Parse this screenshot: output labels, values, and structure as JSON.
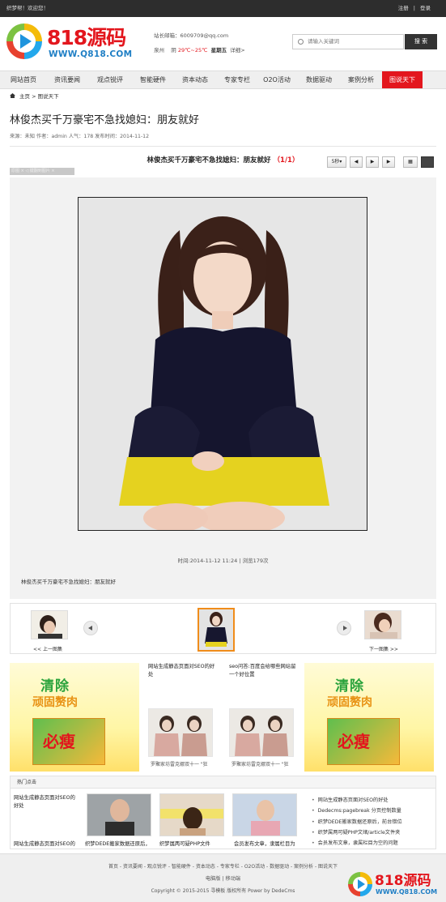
{
  "topbar": {
    "welcome": "织梦帮！欢迎您！",
    "register": "注册",
    "sep": "|",
    "login": "登录"
  },
  "logo": {
    "brand": "818源码",
    "url": "WWW.Q818.COM"
  },
  "site_info": {
    "email_label": "站长邮箱：6009709@qq.com",
    "city": "泉州",
    "weather": "阴",
    "temp": "29℃~25℃",
    "weekday": "星期五",
    "detail": "详细>"
  },
  "search": {
    "placeholder": "请输入关键词",
    "button": "搜 索"
  },
  "nav": [
    "网站首页",
    "资讯要闻",
    "观点锐评",
    "智能硬件",
    "资本动态",
    "专家专栏",
    "O2O活动",
    "数据驱动",
    "案例分析",
    "图说天下"
  ],
  "nav_active": 9,
  "breadcrumb": {
    "home": "主页",
    "sep": ">",
    "current": "图说天下"
  },
  "article": {
    "title": "林俊杰买千万豪宅不急找媳妇：朋友就好",
    "meta": "来源：未知 作者：admin 人气：178 发布时间：2014-11-12"
  },
  "gallery": {
    "title": "林俊杰买千万豪宅不急找媳妇：朋友就好",
    "page_open": "（",
    "page_current": "1",
    "page_sep": "/",
    "page_total": "1",
    "page_close": "）",
    "speed": "5秒",
    "tag": "原图  ×  ◁ 键翻到图片 ×",
    "time": "时间:2014-11-12 11:24 | 浏览179次",
    "caption": "林俊杰买千万豪宅不急找媳妇：朋友就好",
    "prev_label": "<< 上一图集",
    "next_label": "下一图集 >>"
  },
  "mid": {
    "item1": "网站生成静态页面对SEO的好处",
    "item2": "seo问答:百度会给哪些网站留一个好位置",
    "cap1": "罗聚家坊雷克娜双十一 \"狂",
    "cap2": "罗聚家坊雷克娜双十一 \"狂"
  },
  "ad": {
    "line1": "清除",
    "line2": "顽固赘肉",
    "brand": "必瘦"
  },
  "hot": {
    "header": "热门点击",
    "left_top": "网站生成静态页面对SEO的好处",
    "left_bottom": "网站生成静态页面对SEO的",
    "caps": [
      "织梦DEDE搬家数据还原后，",
      "织梦属两可疑PHP文件",
      "会员发布文章，隶属栏目为"
    ],
    "list": [
      "网站生成静态页面对SEO的好处",
      "Dedecms:pagebreak 分页控制数量",
      "织梦DEDE搬家数据还原后，前台错位",
      "织梦属两可疑PHP文绪/article文件夹",
      "会员发布文章，隶属栏目为空的问题"
    ]
  },
  "footer": {
    "links": "首页 - 资讯要闻 - 观点锐评 - 智能硬件 - 资本动态 - 专家专栏 - O2O活动 - 数据驱动 - 案例分析 - 图说天下",
    "sub": "电脑版 | 移动端",
    "copyright": "Copyright © 2015-2015 寻模板 版权所有 Power by DedeCms"
  },
  "watermark": {
    "brand": "818源码",
    "url": "WWW.Q818.COM"
  },
  "colors": {
    "accent": "#e3161d",
    "topbar": "#2d2d2d",
    "link_blue": "#1f7fc5",
    "ad_green": "#2aa33c"
  },
  "icons": [
    "home-icon",
    "search-icon",
    "prev-icon",
    "play-icon",
    "next-icon",
    "grid-icon",
    "play-logo-icon"
  ]
}
